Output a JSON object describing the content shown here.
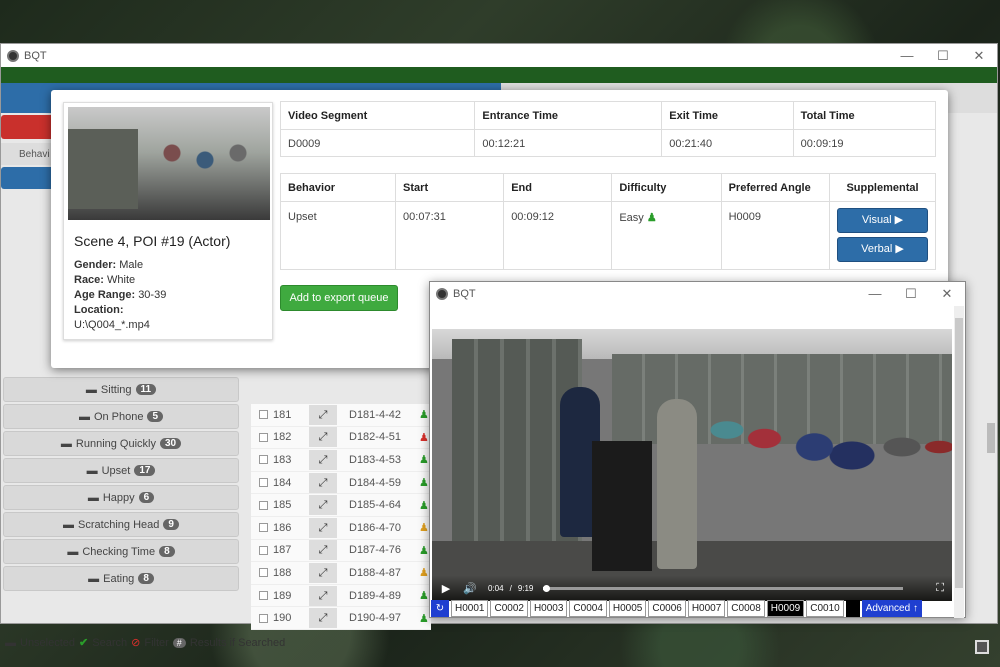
{
  "app": {
    "title": "BQT",
    "window_controls": [
      "—",
      "☐",
      "✕"
    ]
  },
  "tab_label": "Behavi",
  "sidebar": {
    "items": [
      {
        "label": "Sitting",
        "count": "11"
      },
      {
        "label": "On Phone",
        "count": "5"
      },
      {
        "label": "Running Quickly",
        "count": "30"
      },
      {
        "label": "Upset",
        "count": "17"
      },
      {
        "label": "Happy",
        "count": "6"
      },
      {
        "label": "Scratching Head",
        "count": "9"
      },
      {
        "label": "Checking Time",
        "count": "8"
      },
      {
        "label": "Eating",
        "count": "8"
      }
    ]
  },
  "rows": [
    {
      "num": "181",
      "seg": "D181-4-42",
      "icon_color": "#2a9d2a"
    },
    {
      "num": "182",
      "seg": "D182-4-51",
      "icon_color": "#d9302c"
    },
    {
      "num": "183",
      "seg": "D183-4-53",
      "icon_color": "#2a9d2a"
    },
    {
      "num": "184",
      "seg": "D184-4-59",
      "icon_color": "#2a9d2a"
    },
    {
      "num": "185",
      "seg": "D185-4-64",
      "icon_color": "#2a9d2a"
    },
    {
      "num": "186",
      "seg": "D186-4-70",
      "icon_color": "#e0a020"
    },
    {
      "num": "187",
      "seg": "D187-4-76",
      "icon_color": "#2a9d2a"
    },
    {
      "num": "188",
      "seg": "D188-4-87",
      "icon_color": "#e0a020"
    },
    {
      "num": "189",
      "seg": "D189-4-89",
      "icon_color": "#2a9d2a"
    },
    {
      "num": "190",
      "seg": "D190-4-97",
      "icon_color": "#2a9d2a"
    }
  ],
  "statusbar": {
    "unselected": "Unselected",
    "search": "Search",
    "filter": "Filter",
    "results": "Results if Searched",
    "results_badge": "#"
  },
  "modal": {
    "scene_title": "Scene 4, POI #19 (Actor)",
    "gender_label": "Gender:",
    "gender": "Male",
    "race_label": "Race:",
    "race": "White",
    "age_label": "Age Range:",
    "age": "30-39",
    "location_label": "Location:",
    "location": "U:\\Q004_*.mp4",
    "segment_headers": [
      "Video Segment",
      "Entrance Time",
      "Exit Time",
      "Total Time"
    ],
    "segment_values": [
      "D0009",
      "00:12:21",
      "00:21:40",
      "00:09:19"
    ],
    "behavior_headers": [
      "Behavior",
      "Start",
      "End",
      "Difficulty",
      "Preferred Angle",
      "Supplemental"
    ],
    "behavior_values": {
      "behavior": "Upset",
      "start": "00:07:31",
      "end": "00:09:12",
      "difficulty": "Easy",
      "angle": "H0009"
    },
    "visual_label": "Visual ▶",
    "verbal_label": "Verbal ▶",
    "export_label": "Add to export queue"
  },
  "video": {
    "title": "BQT",
    "current_time": "0:04",
    "separator": "/",
    "duration": "9:19",
    "progress": 0.007,
    "cameras": [
      "H0001",
      "C0002",
      "H0003",
      "C0004",
      "H0005",
      "C0006",
      "H0007",
      "C0008",
      "H0009",
      "C0010"
    ],
    "active_camera": "H0009",
    "advanced_label": "Advanced ↑"
  }
}
